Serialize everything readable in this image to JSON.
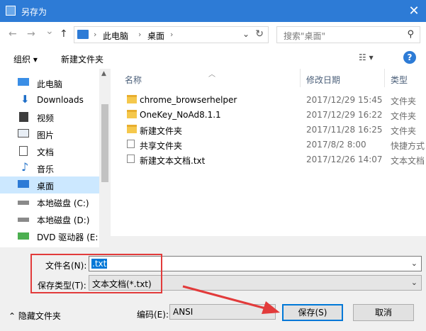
{
  "window": {
    "title": "另存为",
    "close_glyph": "✕"
  },
  "nav": {
    "back_glyph": "←",
    "forward_glyph": "→",
    "recent_glyph": "⌄",
    "up_glyph": "↑",
    "breadcrumb": [
      "此电脑",
      "桌面"
    ],
    "separator": "›",
    "search_placeholder": "搜索\"桌面\"",
    "search_glyph": "⚲",
    "refresh_glyph": "↻",
    "dropdown_glyph": "⌄"
  },
  "toolbar": {
    "organize": "组织 ▾",
    "new_folder": "新建文件夹",
    "view_glyph": "☷ ▾",
    "help": "?"
  },
  "sidebar": {
    "items": [
      {
        "label": "此电脑",
        "icon": "computer-icon"
      },
      {
        "label": "Downloads",
        "icon": "downloads-icon"
      },
      {
        "label": "视频",
        "icon": "videos-icon"
      },
      {
        "label": "图片",
        "icon": "pictures-icon"
      },
      {
        "label": "文档",
        "icon": "documents-icon"
      },
      {
        "label": "音乐",
        "icon": "music-icon"
      },
      {
        "label": "桌面",
        "icon": "desktop-icon",
        "selected": true
      },
      {
        "label": "本地磁盘 (C:)",
        "icon": "drive-icon"
      },
      {
        "label": "本地磁盘 (D:)",
        "icon": "drive-icon"
      },
      {
        "label": "DVD 驱动器 (E:",
        "icon": "dvd-icon"
      }
    ]
  },
  "files": {
    "columns": {
      "name": "名称",
      "date": "修改日期",
      "type": "类型"
    },
    "rows": [
      {
        "name": "chrome_browserhelper",
        "date": "2017/12/29 15:45",
        "type": "文件夹",
        "icon": "folder-icon"
      },
      {
        "name": "OneKey_NoAd8.1.1",
        "date": "2017/12/29 16:22",
        "type": "文件夹",
        "icon": "folder-icon"
      },
      {
        "name": "新建文件夹",
        "date": "2017/11/28 16:25",
        "type": "文件夹",
        "icon": "folder-icon"
      },
      {
        "name": "共享文件夹",
        "date": "2017/8/2 8:00",
        "type": "快捷方式",
        "icon": "shortcut-icon"
      },
      {
        "name": "新建文本文档.txt",
        "date": "2017/12/26 14:07",
        "type": "文本文档",
        "icon": "text-file-icon"
      }
    ]
  },
  "form": {
    "filename_label": "文件名(N):",
    "filename_value": ".txt",
    "filetype_label": "保存类型(T):",
    "filetype_value": "文本文档(*.txt)",
    "hide_folders": "⌃ 隐藏文件夹",
    "encoding_label": "编码(E):",
    "encoding_value": "ANSI",
    "save": "保存(S)",
    "cancel": "取消"
  },
  "colors": {
    "titlebar": "#2d7bd6",
    "selection": "#cce8ff",
    "annotation": "#e23b3b"
  }
}
